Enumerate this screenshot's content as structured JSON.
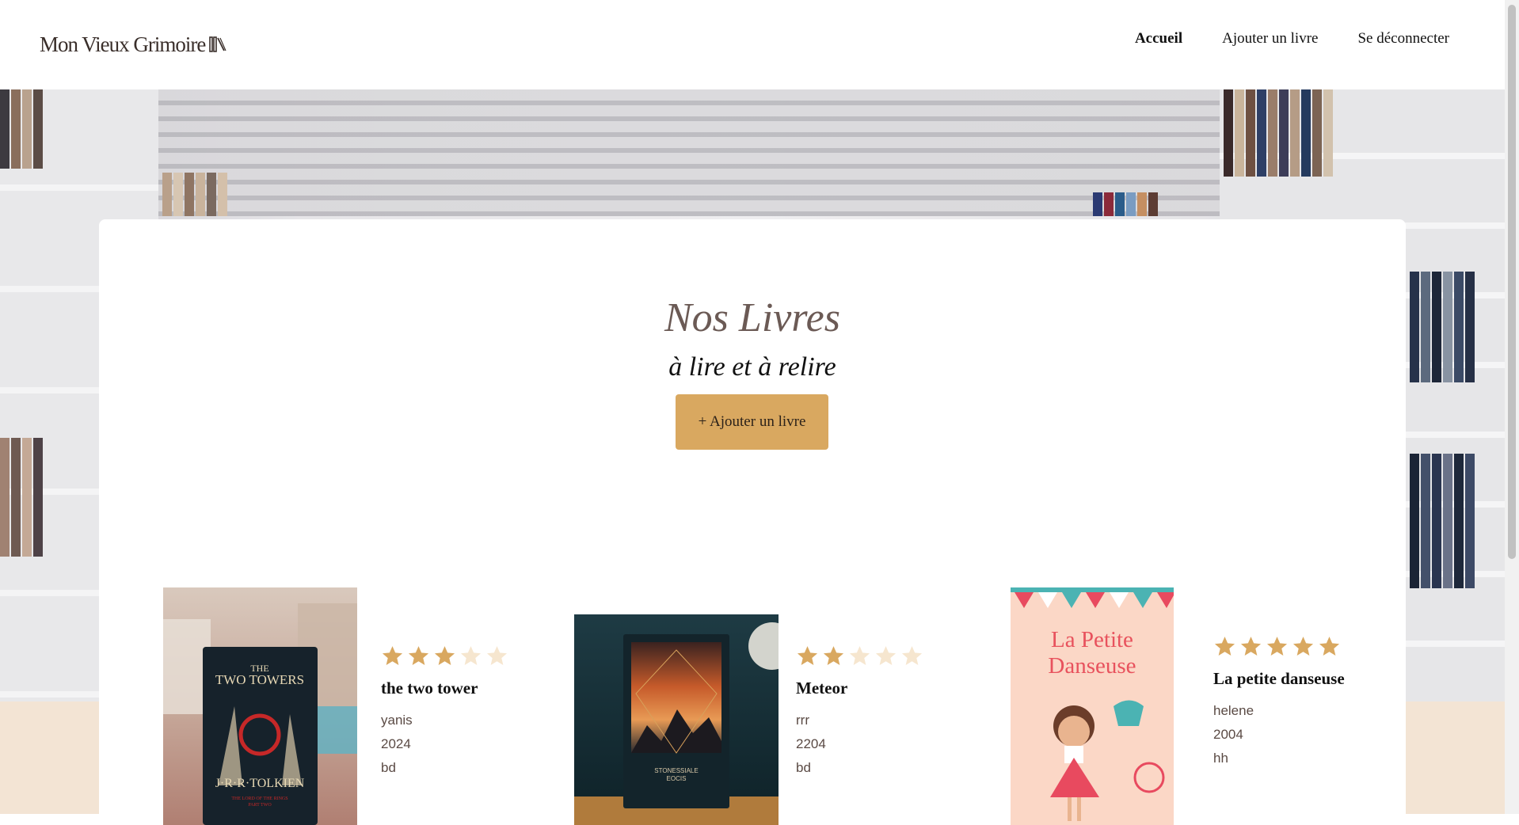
{
  "header": {
    "logo_text": "Mon Vieux Grimoire",
    "nav": [
      {
        "label": "Accueil",
        "active": true
      },
      {
        "label": "Ajouter un livre",
        "active": false
      },
      {
        "label": "Se déconnecter",
        "active": false
      }
    ]
  },
  "main": {
    "title": "Nos Livres",
    "subtitle": "à lire et à relire",
    "add_button_label": "+ Ajouter un livre"
  },
  "books": [
    {
      "title": "the two tower",
      "author": "yanis",
      "year": "2024",
      "genre": "bd",
      "rating": 3
    },
    {
      "title": "Meteor",
      "author": "rrr",
      "year": "2204",
      "genre": "bd",
      "rating": 2
    },
    {
      "title": "La petite danseuse",
      "author": "helene",
      "year": "2004",
      "genre": "hh",
      "rating": 5
    }
  ],
  "covers": {
    "two_towers": {
      "line1": "THE",
      "line2": "TWO TOWERS",
      "author": "J·R·R·TOLKIEN",
      "series": "THE LORD OF THE RINGS",
      "part": "PART TWO"
    },
    "meteor": {
      "line1": "STONESSIALE",
      "line2": "EOCIS"
    },
    "danseuse": {
      "line1": "La Petite",
      "line2": "Danseuse"
    }
  },
  "colors": {
    "accent": "#d9a860",
    "star_filled": "#d9a860",
    "star_empty": "#f6e6cf",
    "title_color": "#6b5a55",
    "band": "#f3e4d4"
  }
}
